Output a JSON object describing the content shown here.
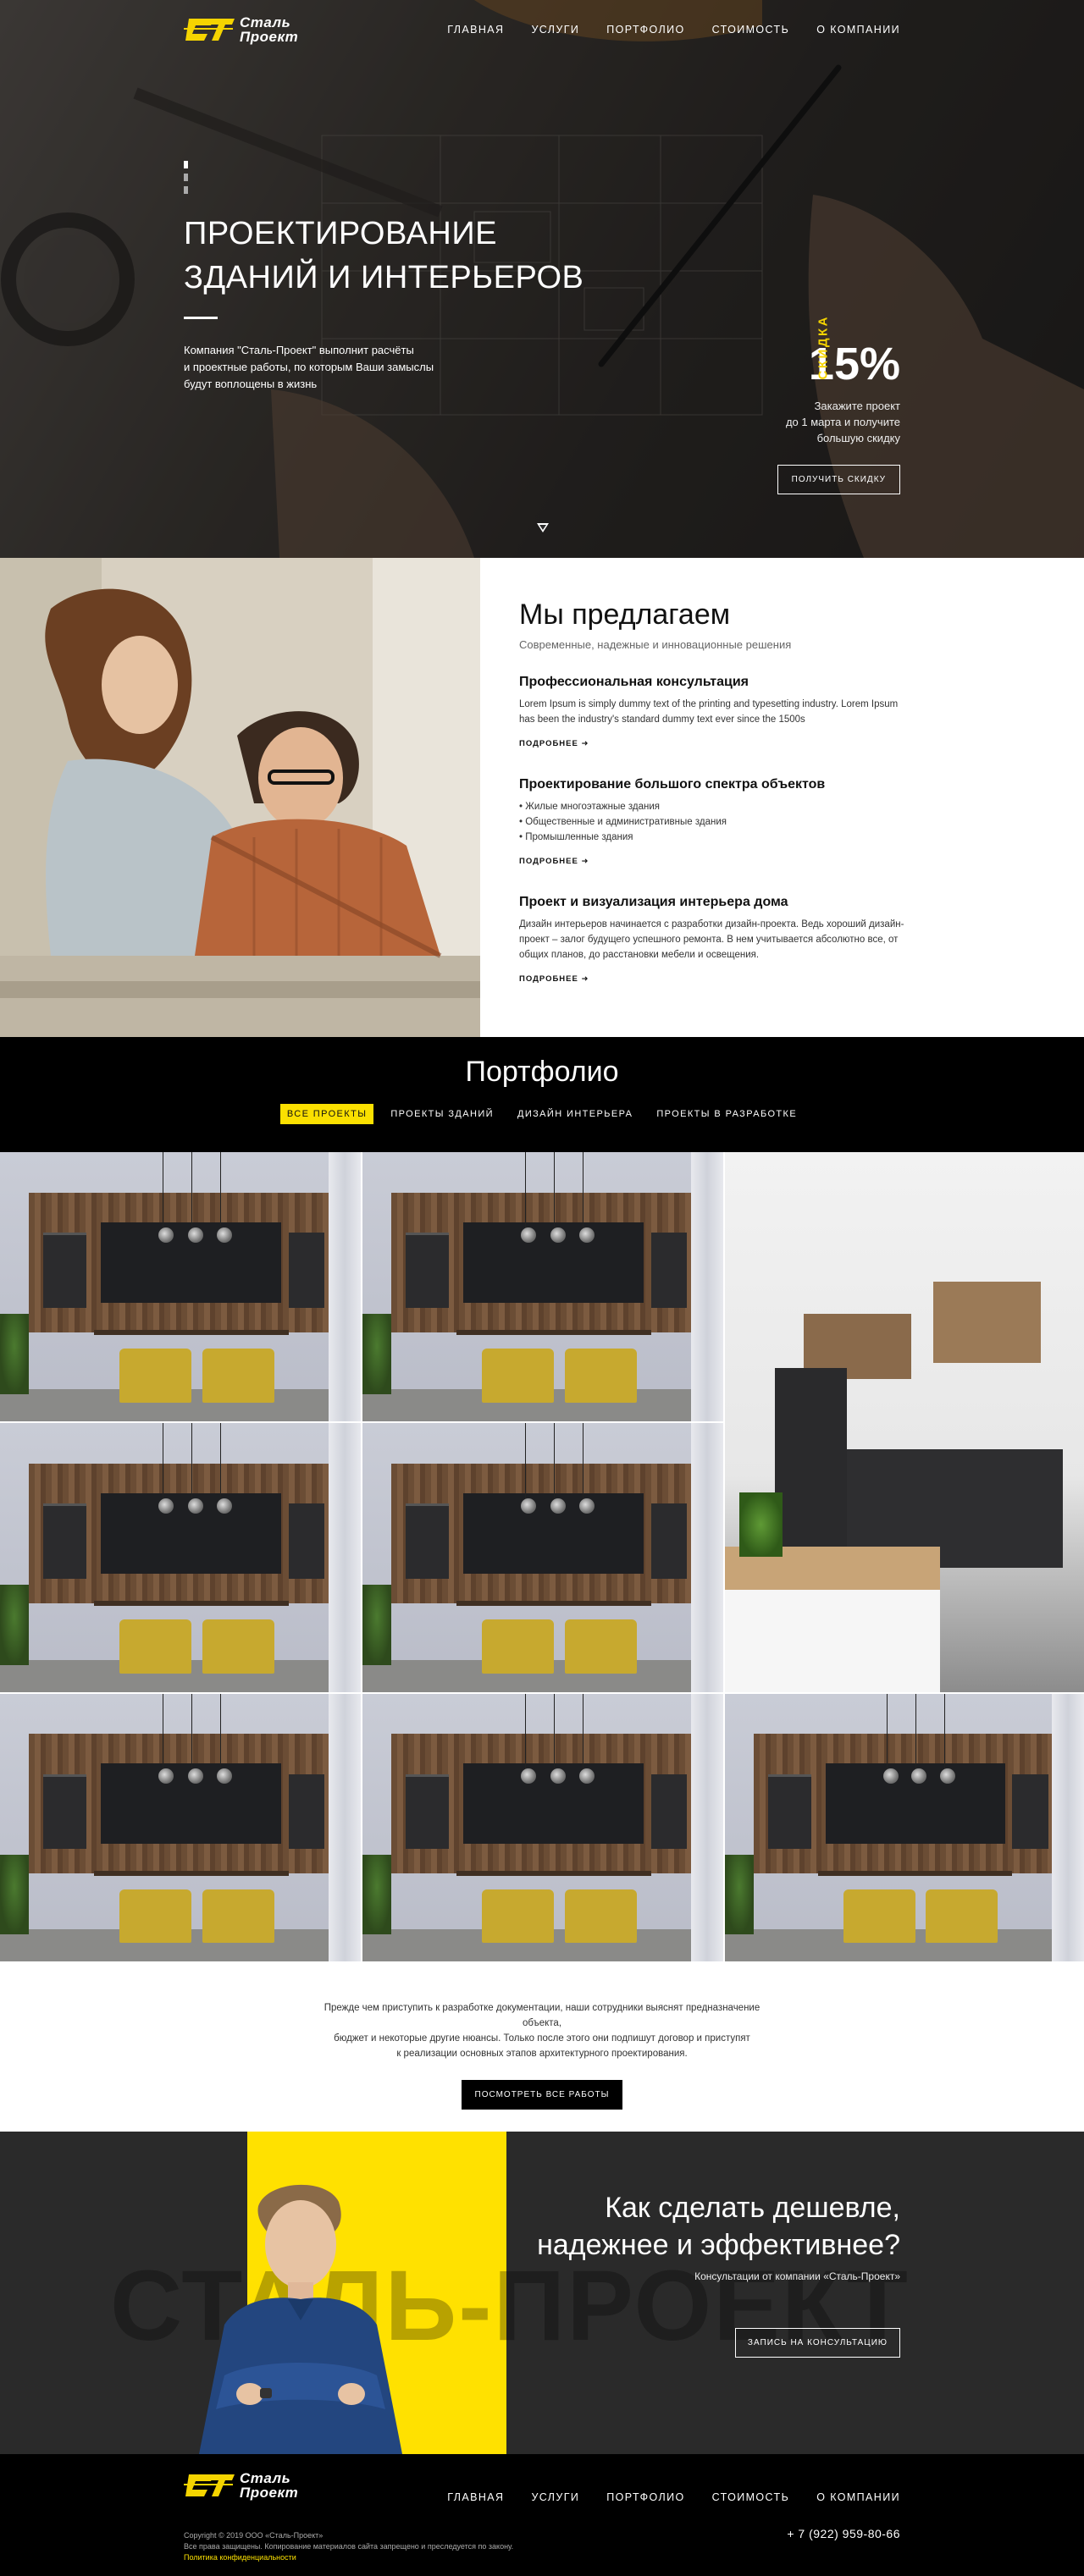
{
  "brand": {
    "line1": "Сталь",
    "line2": "Проект",
    "accent": "#f5d400"
  },
  "nav": [
    "Главная",
    "Услуги",
    "Портфолио",
    "Стоимость",
    "О компании"
  ],
  "hero": {
    "title_line1": "Проектирование",
    "title_line2": "зданий и интерьеров",
    "text_line1": "Компания \"Сталь-Проект\" выполнит расчёты",
    "text_line2": "и проектные работы, по которым Ваши замыслы",
    "text_line3": "будут воплощены в жизнь",
    "promo_label": "Скидка",
    "promo_pct": "15%",
    "promo_line1": "Закажите проект",
    "promo_line2": "до 1 марта и получите",
    "promo_line3": "большую скидку",
    "promo_button": "Получить скидку"
  },
  "offer": {
    "title": "Мы предлагаем",
    "subtitle": "Современные, надежные и инновационные решения",
    "more_label": "Подробнее ➜",
    "services": [
      {
        "title": "Профессиональная консультация",
        "text": "Lorem Ipsum is simply dummy text of the printing and typesetting industry. Lorem Ipsum has been the industry's standard dummy text ever since the 1500s"
      },
      {
        "title": "Проектирование большого спектра объектов",
        "items": [
          "Жилые многоэтажные здания",
          "Общественные и административные здания",
          "Промышленные здания"
        ]
      },
      {
        "title": "Проект и визуализация интерьера дома",
        "text": "Дизайн интерьеров начинается с разработки дизайн-проекта. Ведь хороший дизайн-проект – залог будущего успешного ремонта. В нем учитывается абсолютно все, от общих планов, до расстановки мебели и освещения."
      }
    ]
  },
  "portfolio": {
    "title": "Портфолио",
    "filters": [
      "Все проекты",
      "Проекты зданий",
      "Дизайн интерьера",
      "Проекты в разработке"
    ],
    "active_filter": 0,
    "description_line1": "Прежде чем приступить к разработке документации, наши сотрудники выяснят предназначение объекта,",
    "description_line2": "бюджет и некоторые другие нюансы. Только после этого они подпишут договор и приступят",
    "description_line3": "к реализации основных этапов архитектурного проектирования.",
    "button": "Посмотреть все работы"
  },
  "consult": {
    "watermark": "СТАЛЬ-ПРОЕКТ",
    "title_line1": "Как сделать дешевле,",
    "title_line2": "надежнее и эффективнее?",
    "subtitle": "Консультации от компании «Сталь-Проект»",
    "button": "Запись на консультацию",
    "yellow": "#ffe100"
  },
  "footer": {
    "copyright": "Copyright © 2019 ООО «Сталь-Проект»",
    "rights": "Все права защищены. Копирование материалов сайта запрещено и преследуется по закону.",
    "policy": "Политика конфиденциальности",
    "phone": "+ 7 (922) 959-80-66"
  }
}
